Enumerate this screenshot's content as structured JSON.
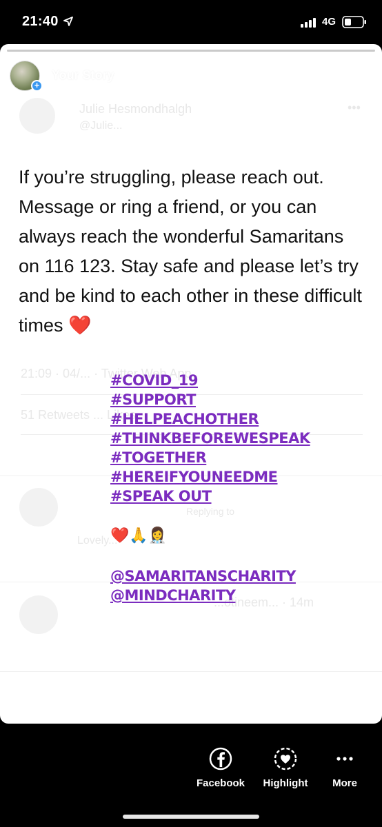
{
  "status_bar": {
    "time": "21:40",
    "network": "4G"
  },
  "story": {
    "title": "Your Story",
    "age": "12s",
    "progress": 0.0
  },
  "background_tweet": {
    "author": "Julie Hesmondhalgh",
    "handle": "@Julie...",
    "meta": "21:09 · 04/... · Twitter Web App",
    "stats": "51 Retweets ... Likes",
    "reply1": "Replying to",
    "reply1_text": "Lovely...",
    "reply2_author": "...otineem... · 14m"
  },
  "tweet": {
    "text": "If you’re struggling, please reach out. Message or ring a friend, or you can always reach the wonderful Samaritans on 116 123. Stay safe and please let’s try and be kind to each other in these difficult times",
    "heart": "❤️"
  },
  "hashtags": [
    "#COVID_19",
    "#SUPPORT",
    "#HELPEACHOTHER",
    "#THINKBEFOREWESPEAK",
    "#TOGETHER",
    "#HEREIFYOUNEEDME",
    "#SPEAK OUT"
  ],
  "emojis": "❤️🙏👩‍⚕️",
  "mentions": [
    "@SAMARITANSCHARITY",
    "@MINDCHARITY"
  ],
  "actions": {
    "facebook": "Facebook",
    "highlight": "Highlight",
    "more": "More"
  },
  "colors": {
    "hashtag": "#7b2cbf",
    "badge": "#3897f0",
    "background": "#000000",
    "card": "#ffffff"
  }
}
